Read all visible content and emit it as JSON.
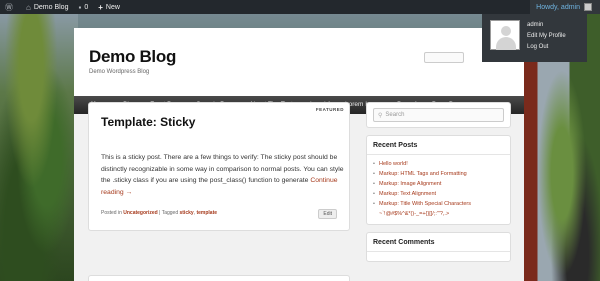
{
  "adminbar": {
    "site_name": "Demo Blog",
    "comments_count": "0",
    "new_label": "New",
    "howdy": "Howdy, admin",
    "dropdown": {
      "username": "admin",
      "edit_profile": "Edit My Profile",
      "logout": "Log Out"
    }
  },
  "header": {
    "title": "Demo Blog",
    "description": "Demo Wordpress Blog"
  },
  "nav": {
    "items": [
      "Home",
      "Blog",
      "Front Page",
      "Sample Page",
      "About The Tests",
      "Level 1",
      "Lorem Ipsum",
      "Page A",
      "Page B"
    ]
  },
  "post": {
    "featured": "FEATURED",
    "title": "Template: Sticky",
    "body": "This is a sticky post. There are a few things to verify: The sticky post should be distinctly recognizable in some way in comparison to normal posts. You can style the .sticky class if you are using the post_class() function to generate ",
    "more": "Continue reading →",
    "meta_posted": "Posted in ",
    "meta_category": "Uncategorized",
    "meta_tagged": " | Tagged ",
    "meta_tag1": "sticky",
    "meta_sep": ", ",
    "meta_tag2": "template",
    "edit": "Edit"
  },
  "sidebar": {
    "search_placeholder": "Search",
    "recent_posts_title": "Recent Posts",
    "recent_posts": [
      "Hello world!",
      "Markup: HTML Tags and Formatting",
      "Markup: Image Alignment",
      "Markup: Text Alignment",
      "Markup: Title With Special Characters",
      "~`!@#$%^&*()-_=+{}[]/;:'\"?,.>"
    ],
    "recent_comments_title": "Recent Comments"
  },
  "colors": {
    "adminbar": "#23282d",
    "nav": "#252525",
    "link": "#a63a1c"
  }
}
